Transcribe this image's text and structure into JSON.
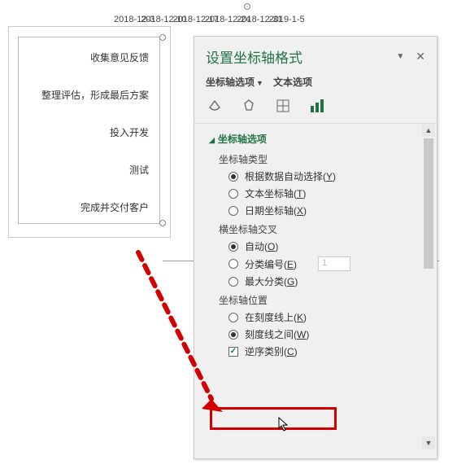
{
  "axis_dates": [
    "2018-12-3",
    "2018-12-10",
    "2018-12-17",
    "2018-12-24",
    "2018-12-31",
    "2019-1-5"
  ],
  "categories": [
    "收集意见反馈",
    "整理评估，形成最后方案",
    "投入开发",
    "测试",
    "完成并交付客户"
  ],
  "pane": {
    "title": "设置坐标轴格式",
    "tabs": {
      "axis_options": "坐标轴选项",
      "text_options": "文本选项"
    },
    "section_axis_options": "坐标轴选项",
    "axis_type_label": "坐标轴类型",
    "axis_type": {
      "auto": {
        "text": "根据数据自动选择(",
        "key": "Y",
        "suffix": ")"
      },
      "text": {
        "text": "文本坐标轴(",
        "key": "T",
        "suffix": ")"
      },
      "date": {
        "text": "日期坐标轴(",
        "key": "X",
        "suffix": ")"
      }
    },
    "cross_label": "横坐标轴交叉",
    "cross": {
      "auto": {
        "text": "自动(",
        "key": "O",
        "suffix": ")"
      },
      "cat": {
        "text": "分类编号(",
        "key": "E",
        "suffix": ")"
      },
      "max": {
        "text": "最大分类(",
        "key": "G",
        "suffix": ")"
      }
    },
    "cross_value": "1",
    "pos_label": "坐标轴位置",
    "pos": {
      "on": {
        "text": "在刻度线上(",
        "key": "K",
        "suffix": ")"
      },
      "between": {
        "text": "刻度线之间(",
        "key": "W",
        "suffix": ")"
      }
    },
    "reverse": {
      "text": "逆序类别(",
      "key": "C",
      "suffix": ")"
    }
  }
}
